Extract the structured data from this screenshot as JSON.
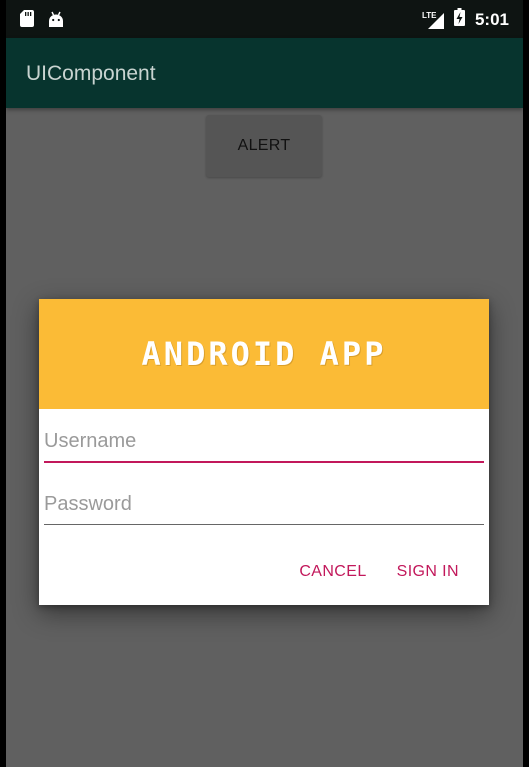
{
  "status_bar": {
    "time": "5:01",
    "network_label": "LTE",
    "icons": [
      "sd-card-icon",
      "android-icon",
      "signal-icon",
      "battery-charging-icon"
    ]
  },
  "app_bar": {
    "title": "UIComponent"
  },
  "main": {
    "alert_button_label": "ALERT"
  },
  "dialog": {
    "banner_text": "ANDROID APP",
    "username": {
      "value": "",
      "placeholder": "Username"
    },
    "password": {
      "value": "",
      "placeholder": "Password"
    },
    "actions": {
      "cancel_label": "CANCEL",
      "sign_in_label": "SIGN IN"
    }
  },
  "colors": {
    "status_bar": "#0e1412",
    "app_bar": "#07342e",
    "dim_background": "#606060",
    "banner": "#fbbb36",
    "accent": "#c2185b"
  }
}
